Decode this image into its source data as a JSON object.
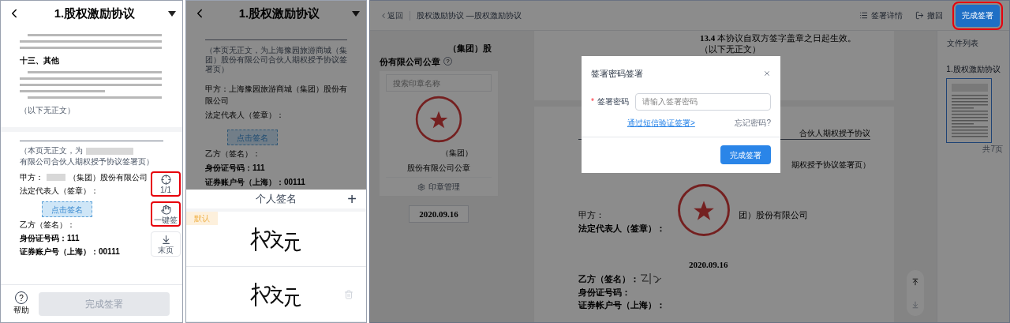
{
  "phone_doc_view": {
    "header": {
      "title": "1.股权激励协议"
    },
    "page_1": {
      "section": "十三、其他",
      "end_note": "（以下无正文）"
    },
    "page_2": {
      "note_start": "（本页无正文，为",
      "note_end": "有限公司合伙人期权授予协议签署页）",
      "party_a_label": "甲方：",
      "party_a_name": "（集团）股份有限公司",
      "legal_rep": "法定代表人（签章）：",
      "sign_here": "点击签名",
      "party_b": "乙方（签名）：",
      "id_number": "身份证号码：111",
      "account": "证券账户号（上海）：00111"
    },
    "tools": [
      {
        "kind": "locate",
        "label": "1/1",
        "highlighted": true
      },
      {
        "kind": "hand",
        "label": "一键签",
        "highlighted": true
      },
      {
        "kind": "last",
        "label": "末页",
        "highlighted": false
      }
    ],
    "help": {
      "icon": "?",
      "label": "帮助"
    },
    "finish_button": {
      "label": "完成签署",
      "disabled": true
    }
  },
  "phone_signature_picker": {
    "header": {
      "title": "1.股权激励协议"
    },
    "page": {
      "note": "（本页无正文，为上海豫园旅游商城（集团）股份有限公司合伙人期权授予协议签署页）",
      "party_a": "甲方：上海豫园旅游商城（集团）股份有限公司",
      "legal_rep": "法定代表人（签章）：",
      "sign_here": "点击签名",
      "party_b": "乙方（签名）：",
      "id_number": "身份证号码：111",
      "account": "证券账户号（上海）：00111"
    },
    "sheet": {
      "title": "个人签名",
      "add": "+",
      "signatures": [
        {
          "badge": "默认",
          "deletable": false
        },
        {
          "deletable": true
        }
      ]
    }
  },
  "web_sign_page": {
    "top_bar": {
      "back": "返回",
      "title": "股权激励协议 —股权激励协议",
      "actions": [
        {
          "kind": "details",
          "label": "签署详情"
        },
        {
          "kind": "withdraw",
          "label": "撤回"
        }
      ],
      "finish_button": {
        "label": "完成签署",
        "highlighted": true
      }
    },
    "seal_panel": {
      "title_top": "（集团）股",
      "title": "份有限公司公章",
      "help": "?",
      "search_placeholder": "搜索印章名称",
      "seal_caption_1": "（集团）",
      "seal_caption_2": "股份有限公司公章",
      "manage": "印章管理",
      "date": "2020.09.16"
    },
    "document": {
      "clause": "**13.4** 本协议自双方签字盖章之日起生效。",
      "end_note": "（以下无正文）",
      "page_header_right": "合伙人期权授予协议",
      "page_title_partial": "期权授予协议签署页）",
      "party_a_label": "甲方：",
      "party_a_name": "团）股份有限公司",
      "legal_rep": "法定代表人（签章）：",
      "date": "2020.09.16",
      "party_b": "乙方（签名）：",
      "id_number": "身份证号码：",
      "account": "证券帐户号（上海）："
    },
    "file_list": {
      "title": "文件列表",
      "files": [
        {
          "name": "1.股权激励协议",
          "selected": true
        }
      ],
      "page_count": "共7页"
    },
    "dialog": {
      "title": "签署密码签署",
      "field_label": "签署密码",
      "required": true,
      "required_mark": "*",
      "placeholder": "请输入签署密码",
      "sms_link": "通过短信验证签署>",
      "forgot_link": "忘记密码?",
      "submit": "完成签署"
    }
  }
}
